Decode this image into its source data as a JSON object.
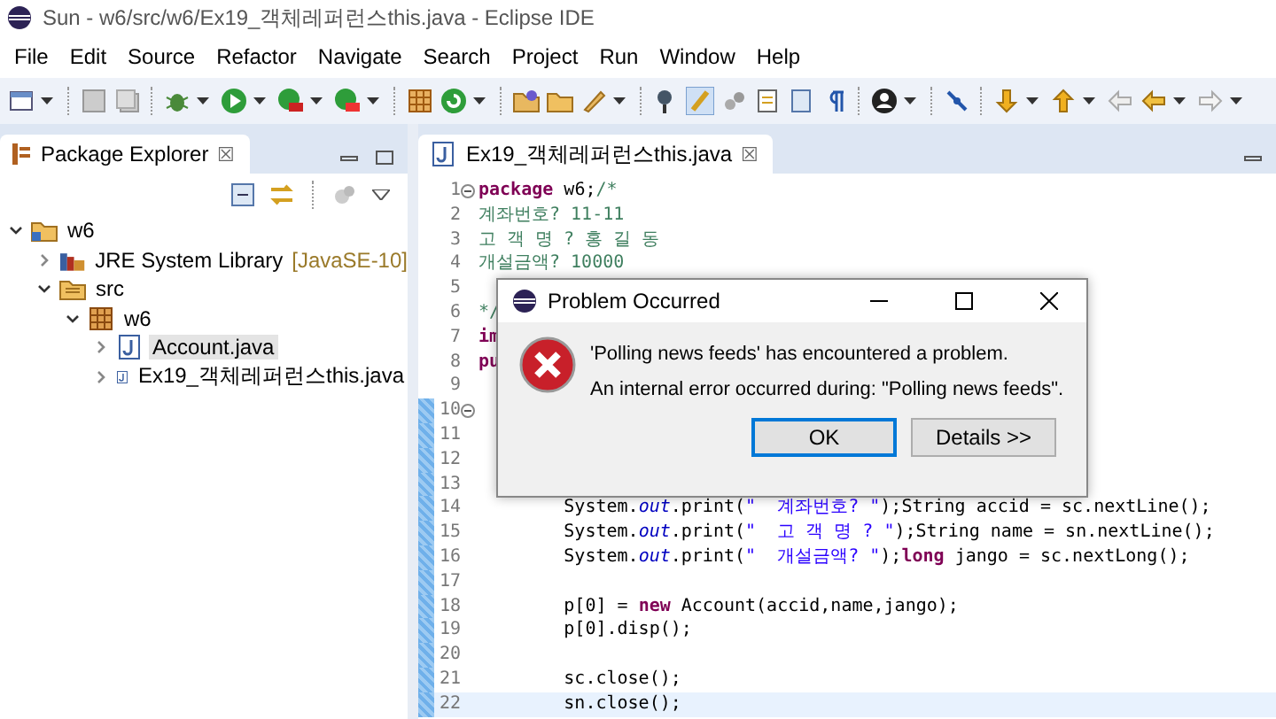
{
  "window": {
    "title": "Sun - w6/src/w6/Ex19_객체레퍼런스this.java - Eclipse IDE"
  },
  "menu": [
    "File",
    "Edit",
    "Source",
    "Refactor",
    "Navigate",
    "Search",
    "Project",
    "Run",
    "Window",
    "Help"
  ],
  "package_explorer": {
    "title": "Package Explorer",
    "close": "☒",
    "tree": [
      {
        "label": "w6",
        "kind": "project",
        "expanded": true,
        "selected": false,
        "children": [
          {
            "label": "JRE System Library",
            "decoration": "[JavaSE-10]",
            "kind": "library",
            "expanded": false,
            "selected": false
          },
          {
            "label": "src",
            "kind": "folder",
            "expanded": true,
            "selected": false,
            "children": [
              {
                "label": "w6",
                "kind": "package",
                "expanded": true,
                "selected": false,
                "children": [
                  {
                    "label": "Account.java",
                    "kind": "java",
                    "expanded": false,
                    "selected": true
                  },
                  {
                    "label": "Ex19_객체레퍼런스this.java",
                    "kind": "java",
                    "expanded": false,
                    "selected": false
                  }
                ]
              }
            ]
          }
        ]
      }
    ]
  },
  "editor": {
    "tab": {
      "label": "Ex19_객체레퍼런스this.java",
      "close": "☒"
    },
    "lines": [
      {
        "number": "1",
        "fold": true,
        "range": false,
        "current": false,
        "segments": [
          {
            "kind": "keyword",
            "text": "package"
          },
          {
            "kind": "plain",
            "text": " w6;"
          },
          {
            "kind": "comment",
            "text": "/*"
          }
        ]
      },
      {
        "number": "2",
        "fold": false,
        "range": false,
        "current": false,
        "segments": [
          {
            "kind": "comment",
            "text": "계좌번호? 11-11"
          }
        ]
      },
      {
        "number": "3",
        "fold": false,
        "range": false,
        "current": false,
        "segments": [
          {
            "kind": "comment",
            "text": "고 객 명 ? 홍 길 동"
          }
        ]
      },
      {
        "number": "4",
        "fold": false,
        "range": false,
        "current": false,
        "segments": [
          {
            "kind": "comment",
            "text": "개설금액? 10000"
          }
        ]
      },
      {
        "number": "5",
        "fold": false,
        "range": false,
        "current": false
      },
      {
        "number": "6",
        "fold": false,
        "range": false,
        "current": false,
        "segments": [
          {
            "kind": "comment",
            "text": "*/"
          }
        ]
      },
      {
        "number": "7",
        "fold": false,
        "range": false,
        "current": false,
        "segments": [
          {
            "kind": "keyword",
            "text": "im"
          }
        ]
      },
      {
        "number": "8",
        "fold": false,
        "range": false,
        "current": false,
        "segments": [
          {
            "kind": "keyword",
            "text": "pu"
          }
        ]
      },
      {
        "number": "9",
        "fold": false,
        "range": false,
        "current": false
      },
      {
        "number": "10",
        "fold": true,
        "range": true,
        "current": false
      },
      {
        "number": "11",
        "fold": false,
        "range": true,
        "current": false
      },
      {
        "number": "12",
        "fold": false,
        "range": true,
        "current": false
      },
      {
        "number": "13",
        "fold": false,
        "range": true,
        "current": false
      },
      {
        "number": "14",
        "fold": false,
        "range": true,
        "current": false,
        "segments": [
          {
            "kind": "plain",
            "text": "        System."
          },
          {
            "kind": "field",
            "text": "out"
          },
          {
            "kind": "plain",
            "text": ".print("
          },
          {
            "kind": "string",
            "text": "\"  계좌번호? \""
          },
          {
            "kind": "plain",
            "text": ");String accid = sc.nextLine();"
          }
        ]
      },
      {
        "number": "15",
        "fold": false,
        "range": true,
        "current": false,
        "segments": [
          {
            "kind": "plain",
            "text": "        System."
          },
          {
            "kind": "field",
            "text": "out"
          },
          {
            "kind": "plain",
            "text": ".print("
          },
          {
            "kind": "string",
            "text": "\"  고 객 명 ? \""
          },
          {
            "kind": "plain",
            "text": ");String name = sn.nextLine();"
          }
        ]
      },
      {
        "number": "16",
        "fold": false,
        "range": true,
        "current": false,
        "segments": [
          {
            "kind": "plain",
            "text": "        System."
          },
          {
            "kind": "field",
            "text": "out"
          },
          {
            "kind": "plain",
            "text": ".print("
          },
          {
            "kind": "string",
            "text": "\"  개설금액? \""
          },
          {
            "kind": "plain",
            "text": ");"
          },
          {
            "kind": "keyword",
            "text": "long"
          },
          {
            "kind": "plain",
            "text": " jango = sc.nextLong();"
          }
        ]
      },
      {
        "number": "17",
        "fold": false,
        "range": true,
        "current": false
      },
      {
        "number": "18",
        "fold": false,
        "range": true,
        "current": false,
        "segments": [
          {
            "kind": "plain",
            "text": "        p[0] = "
          },
          {
            "kind": "keyword",
            "text": "new"
          },
          {
            "kind": "plain",
            "text": " Account(accid,name,jango);"
          }
        ]
      },
      {
        "number": "19",
        "fold": false,
        "range": true,
        "current": false,
        "segments": [
          {
            "kind": "plain",
            "text": "        p[0].disp();"
          }
        ]
      },
      {
        "number": "20",
        "fold": false,
        "range": true,
        "current": false
      },
      {
        "number": "21",
        "fold": false,
        "range": true,
        "current": false,
        "segments": [
          {
            "kind": "plain",
            "text": "        sc.close();"
          }
        ]
      },
      {
        "number": "22",
        "fold": false,
        "range": true,
        "current": true,
        "segments": [
          {
            "kind": "plain",
            "text": "        sn.close();"
          }
        ]
      }
    ]
  },
  "dialog": {
    "title": "Problem Occurred",
    "message": "'Polling news feeds' has encountered a problem.",
    "detail": "An internal error occurred during: \"Polling news feeds\".",
    "buttons": [
      {
        "label": "OK",
        "selected": true
      },
      {
        "label": "Details >>",
        "selected": false
      }
    ]
  }
}
